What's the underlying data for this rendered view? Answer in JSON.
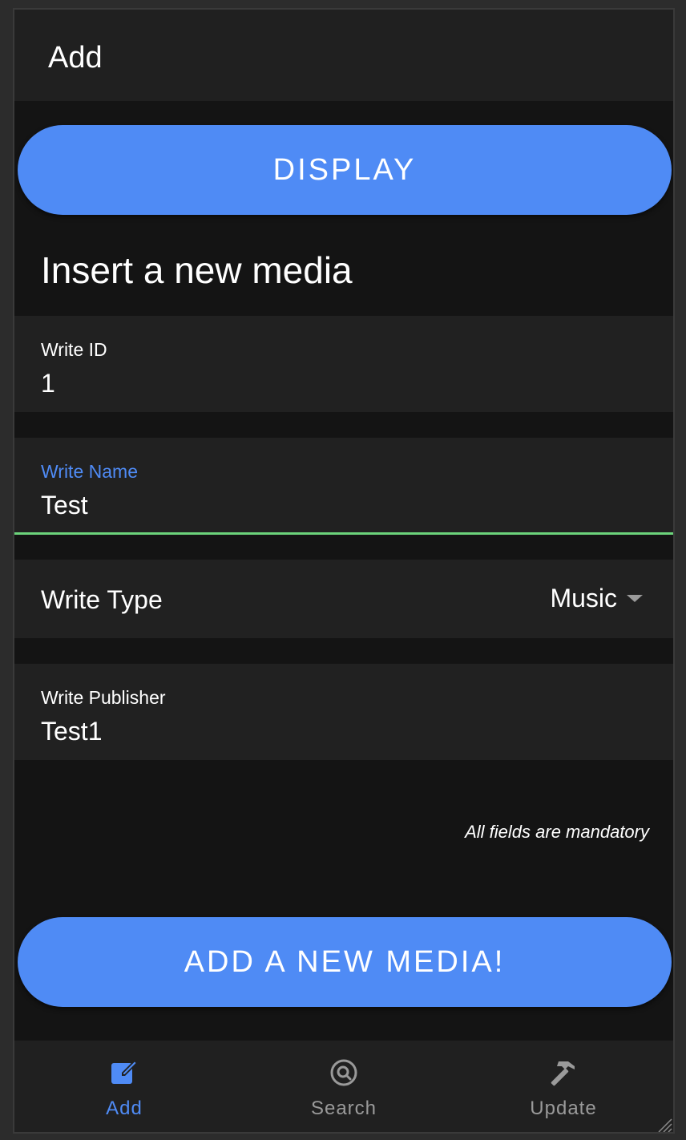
{
  "colors": {
    "accent": "#4f8bf5",
    "focus_underline": "#6cd47b",
    "background": "#141414",
    "surface": "#212121",
    "inactive": "#9a9a9a"
  },
  "appbar": {
    "title": "Add"
  },
  "display_button": {
    "label": "DISPLAY"
  },
  "form": {
    "heading": "Insert a new media",
    "id_field": {
      "label": "Write ID",
      "value": "1"
    },
    "name_field": {
      "label": "Write Name",
      "value": "Test",
      "focused": true
    },
    "type_field": {
      "label": "Write Type",
      "selected": "Music",
      "icon": "caret-down-icon"
    },
    "publisher_field": {
      "label": "Write Publisher",
      "value": "Test1"
    },
    "note": "All fields are mandatory"
  },
  "submit_button": {
    "label": "ADD A NEW MEDIA!"
  },
  "bottom_nav": {
    "items": [
      {
        "label": "Add",
        "icon": "edit-icon",
        "active": true
      },
      {
        "label": "Search",
        "icon": "search-icon",
        "active": false
      },
      {
        "label": "Update",
        "icon": "hammer-icon",
        "active": false
      }
    ]
  }
}
